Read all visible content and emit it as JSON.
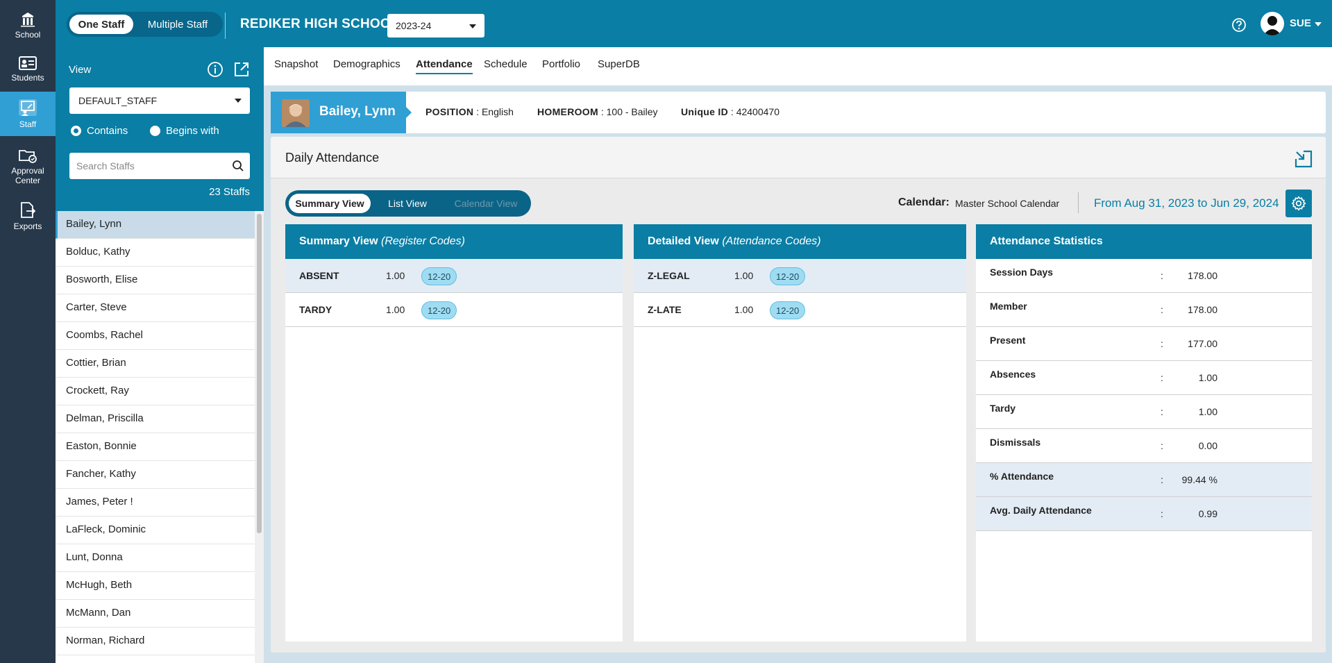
{
  "rail": [
    {
      "label": "School",
      "icon": "school-icon"
    },
    {
      "label": "Students",
      "icon": "students-icon"
    },
    {
      "label": "Staff",
      "icon": "staff-icon"
    },
    {
      "label": "Approval Center",
      "icon": "approval-center-icon"
    },
    {
      "label": "Exports",
      "icon": "exports-icon"
    }
  ],
  "topbar": {
    "toggle_on": "One Staff",
    "toggle_off": "Multiple Staff",
    "school_name": "REDIKER HIGH SCHOOL",
    "year": "2023-24",
    "user": "SUE"
  },
  "panel": {
    "view_label": "View",
    "view_value": "DEFAULT_STAFF",
    "radio_contains": "Contains",
    "radio_begins": "Begins with",
    "search_placeholder": "Search Staffs",
    "count": "23 Staffs",
    "staff": [
      "Bailey, Lynn",
      "Bolduc, Kathy",
      "Bosworth, Elise",
      "Carter, Steve",
      "Coombs, Rachel",
      "Cottier, Brian",
      "Crockett, Ray",
      "Delman, Priscilla",
      "Easton, Bonnie",
      "Fancher, Kathy",
      "James, Peter !",
      "LaFleck, Dominic",
      "Lunt, Donna",
      "McHugh, Beth",
      "McMann, Dan",
      "Norman, Richard"
    ]
  },
  "tabs": [
    "Snapshot",
    "Demographics",
    "Attendance",
    "Schedule",
    "Portfolio",
    "SuperDB"
  ],
  "profile": {
    "name": "Bailey, Lynn",
    "position_label": "POSITION",
    "position_value": ": English",
    "homeroom_label": "HOMEROOM",
    "homeroom_value": ": 100 - Bailey",
    "uid_label": "Unique ID",
    "uid_value": ": 42400470"
  },
  "attendance": {
    "title": "Daily Attendance",
    "views": [
      "Summary View",
      "List View",
      "Calendar View"
    ],
    "calendar_label": "Calendar:",
    "calendar_value": "Master School Calendar",
    "range": "From Aug 31, 2023 to Jun 29, 2024",
    "summary": {
      "title": "Summary View",
      "subtitle": "(Register Codes)",
      "rows": [
        {
          "code": "ABSENT",
          "value": "1.00",
          "tag": "12-20"
        },
        {
          "code": "TARDY",
          "value": "1.00",
          "tag": "12-20"
        }
      ]
    },
    "detailed": {
      "title": "Detailed View",
      "subtitle": "(Attendance Codes)",
      "rows": [
        {
          "code": "Z-LEGAL",
          "value": "1.00",
          "tag": "12-20"
        },
        {
          "code": "Z-LATE",
          "value": "1.00",
          "tag": "12-20"
        }
      ]
    },
    "stats": {
      "title": "Attendance Statistics",
      "rows": [
        {
          "label": "Session Days",
          "value": "178.00"
        },
        {
          "label": "Member",
          "value": "178.00"
        },
        {
          "label": "Present",
          "value": "177.00"
        },
        {
          "label": "Absences",
          "value": "1.00"
        },
        {
          "label": "Tardy",
          "value": "1.00"
        },
        {
          "label": "Dismissals",
          "value": "0.00"
        },
        {
          "label": "% Attendance",
          "value": "99.44 %"
        },
        {
          "label": "Avg. Daily Attendance",
          "value": "0.99"
        }
      ]
    }
  },
  "colors": {
    "primary": "#0a7ea4",
    "rail": "#26384a",
    "accent": "#2f9fd4",
    "tag": "#9fdcf2"
  }
}
